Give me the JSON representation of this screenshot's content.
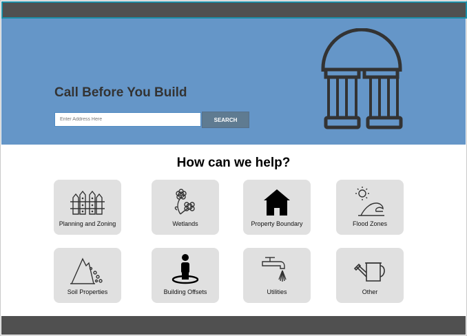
{
  "hero": {
    "title": "Call Before You Build",
    "search_placeholder": "Enter Address Here",
    "search_button": "SEARCH"
  },
  "help": {
    "title": "How can we help?",
    "cards": [
      {
        "label": "Planning and Zoning",
        "icon": "fence-icon"
      },
      {
        "label": "Wetlands",
        "icon": "flowers-icon"
      },
      {
        "label": "Property Boundary",
        "icon": "house-icon"
      },
      {
        "label": "Flood Zones",
        "icon": "sun-wave-icon"
      },
      {
        "label": "Soil Properties",
        "icon": "soil-hill-icon"
      },
      {
        "label": "Building Offsets",
        "icon": "person-location-icon"
      },
      {
        "label": "Utilities",
        "icon": "faucet-icon"
      },
      {
        "label": "Other",
        "icon": "watering-can-icon"
      }
    ]
  },
  "colors": {
    "hero_bg": "#6596c8",
    "topbar": "#505050",
    "button": "#5f7b91",
    "card_bg": "#e0e0e0"
  }
}
